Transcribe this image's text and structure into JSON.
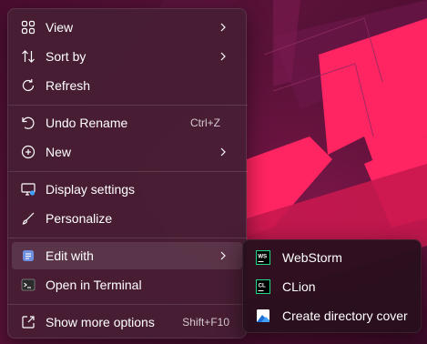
{
  "menu": {
    "items": [
      {
        "label": "View",
        "icon": "view-grid-icon",
        "submenu": true
      },
      {
        "label": "Sort by",
        "icon": "sort-icon",
        "submenu": true
      },
      {
        "label": "Refresh",
        "icon": "refresh-icon"
      },
      {
        "label": "Undo Rename",
        "icon": "undo-icon",
        "shortcut": "Ctrl+Z"
      },
      {
        "label": "New",
        "icon": "plus-circle-icon",
        "submenu": true
      },
      {
        "label": "Display settings",
        "icon": "display-settings-icon"
      },
      {
        "label": "Personalize",
        "icon": "brush-icon"
      },
      {
        "label": "Edit with",
        "icon": "edit-with-icon",
        "submenu": true,
        "highlighted": true
      },
      {
        "label": "Open in Terminal",
        "icon": "terminal-icon"
      },
      {
        "label": "Show more options",
        "icon": "show-more-icon",
        "shortcut": "Shift+F10"
      }
    ]
  },
  "submenu": {
    "items": [
      {
        "label": "WebStorm",
        "icon": "webstorm-icon",
        "icon_text": "WS"
      },
      {
        "label": "CLion",
        "icon": "clion-icon",
        "icon_text": "CL"
      },
      {
        "label": "Create directory cover",
        "icon": "image-icon"
      }
    ]
  },
  "colors": {
    "menu_bg": "#46203a",
    "accent_pink": "#ff2a6a",
    "text": "#ffffff"
  }
}
